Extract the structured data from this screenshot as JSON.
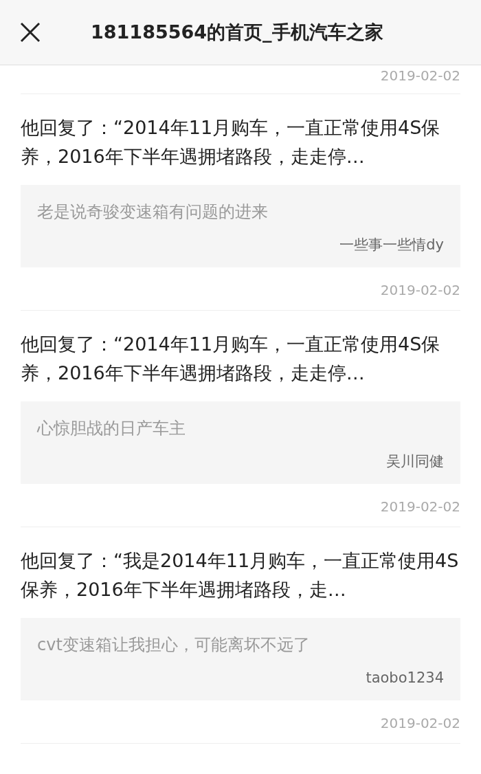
{
  "header": {
    "title": "181185564的首页_手机汽车之家"
  },
  "top_date": "2019-02-02",
  "replies": [
    {
      "text": "他回复了：“2014年11月购车，一直正常使用4S保养，2016年下半年遇拥堵路段，走走停…",
      "quote": "老是说奇骏变速箱有问题的进来",
      "author": "一些事一些情dy",
      "date": "2019-02-02"
    },
    {
      "text": "他回复了：“2014年11月购车，一直正常使用4S保养，2016年下半年遇拥堵路段，走走停…",
      "quote": "心惊胆战的日产车主",
      "author": "吴川同健",
      "date": "2019-02-02"
    },
    {
      "text": "他回复了：“我是2014年11月购车，一直正常使用4S保养，2016年下半年遇拥堵路段，走…",
      "quote": "cvt变速箱让我担心，可能离坏不远了",
      "author": "taobo1234",
      "date": "2019-02-02"
    }
  ]
}
